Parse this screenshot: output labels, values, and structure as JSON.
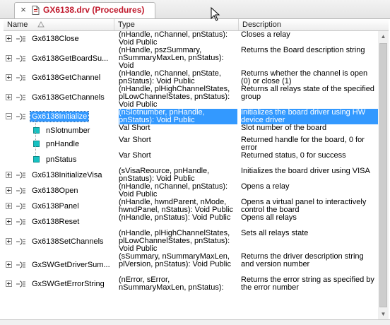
{
  "tab": {
    "title": "GX6138.drv (Procedures)",
    "close_glyph": "×"
  },
  "columns": {
    "name": "Name",
    "type": "Type",
    "description": "Description"
  },
  "rows": [
    {
      "kind": "method",
      "name": "Gx6138Close",
      "type": "(nHandle, nChannel, pnStatus): Void Public",
      "desc": "Closes a relay"
    },
    {
      "kind": "method",
      "name": "Gx6138GetBoardSu...",
      "type": "(nHandle, pszSummary, nSummaryMaxLen, pnStatus): Void",
      "desc": "Returns the Board description string"
    },
    {
      "kind": "method",
      "name": "Gx6138GetChannel",
      "type": "(nHandle, nChannel, pnState, pnStatus): Void Public",
      "desc": "Returns whether the channel is open (0) or close (1)"
    },
    {
      "kind": "method",
      "name": "Gx6138GetChannels",
      "type": "(nHandle, plHighChannelStates, plLowChannelStates, pnStatus): Void Public",
      "desc": "Returns all relays state of the specified group"
    },
    {
      "kind": "method-expanded",
      "name": "Gx6138Initialize",
      "type": "(nSlotnumber, pnHandle, pnStatus): Void Public",
      "desc": "Initializes the board driver using HW device driver"
    },
    {
      "kind": "param",
      "name": "nSlotnumber",
      "type": "Val Short",
      "desc": "Slot number of the board"
    },
    {
      "kind": "param",
      "name": "pnHandle",
      "type": "Var Short",
      "desc": "Returned handle for the board, 0 for error"
    },
    {
      "kind": "param",
      "name": "pnStatus",
      "type": "Var Short",
      "desc": "Returned status, 0 for success"
    },
    {
      "kind": "method",
      "name": "Gx6138InitializeVisa",
      "type": "(sVisaReource, pnHandle, pnStatus): Void Public",
      "desc": "Initializes the board driver using VISA"
    },
    {
      "kind": "method",
      "name": "Gx6138Open",
      "type": "(nHandle, nChannel, pnStatus): Void Public",
      "desc": "Opens a relay"
    },
    {
      "kind": "method",
      "name": "Gx6138Panel",
      "type": "(nHandle, hwndParent, nMode, hwndPanel, nStatus): Void Public",
      "desc": "Opens a virtual panel to interactively control the board"
    },
    {
      "kind": "method",
      "name": "Gx6138Reset",
      "type": "(nHandle, pnStatus): Void Public",
      "desc": "Opens all relays"
    },
    {
      "kind": "method",
      "name": "Gx6138SetChannels",
      "type": "(nHandle, plHighChannelStates, plLowChannelStates, pnStatus): Void Public",
      "desc": "Sets all relays state"
    },
    {
      "kind": "method",
      "name": "GxSWGetDriverSum...",
      "type": "(sSummary, nSummaryMaxLen, plVersion, pnStatus): Void Public",
      "desc": "Returns the driver description string and version number"
    },
    {
      "kind": "method",
      "name": "GxSWGetErrorString",
      "type": "(nError, sError, nSummaryMaxLen, pnStatus): Void Public",
      "desc": "Returns the error string as specified by the error number"
    }
  ],
  "selected_row": "Gx6138Initialize",
  "colors": {
    "selection": "#3399ff",
    "tab_title": "#c0182b",
    "param_icon": "#16c2c2"
  },
  "icons": [
    "close-icon",
    "document-icon",
    "sort-ascending-icon",
    "expand-icon",
    "collapse-icon",
    "method-icon",
    "parameter-icon",
    "scroll-up-icon",
    "scroll-down-icon",
    "mouse-cursor-icon"
  ]
}
